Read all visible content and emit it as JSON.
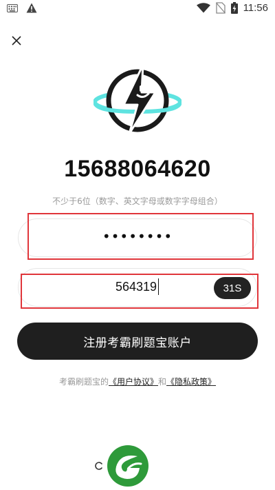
{
  "status_bar": {
    "time": "11:56",
    "left_icons": [
      "keyboard-icon",
      "warning-icon"
    ],
    "right_icons": [
      "wifi-icon",
      "no-sim-icon",
      "battery-charging-icon"
    ]
  },
  "close": {
    "icon": "close-icon"
  },
  "logo": {
    "icon": "lightning-planet-logo",
    "accent_color": "#5ee3e0"
  },
  "phone_number": "15688064620",
  "password_hint": "不少于6位（数字、英文字母或数字字母组合）",
  "password_field": {
    "masked_value": "••••••••"
  },
  "code_field": {
    "value": "564319",
    "timer_label": "31S"
  },
  "register_button": {
    "label": "注册考霸刷题宝账户"
  },
  "agreement": {
    "prefix": "考霸刷题宝的",
    "user_agreement": "《用户协议》",
    "and": "和",
    "privacy_policy": "《隐私政策》"
  },
  "colors": {
    "primary_dark": "#1f1f1f",
    "highlight_red": "#e0353a",
    "hint_gray": "#9a9a9a",
    "brand_green": "#2e9a3a"
  }
}
